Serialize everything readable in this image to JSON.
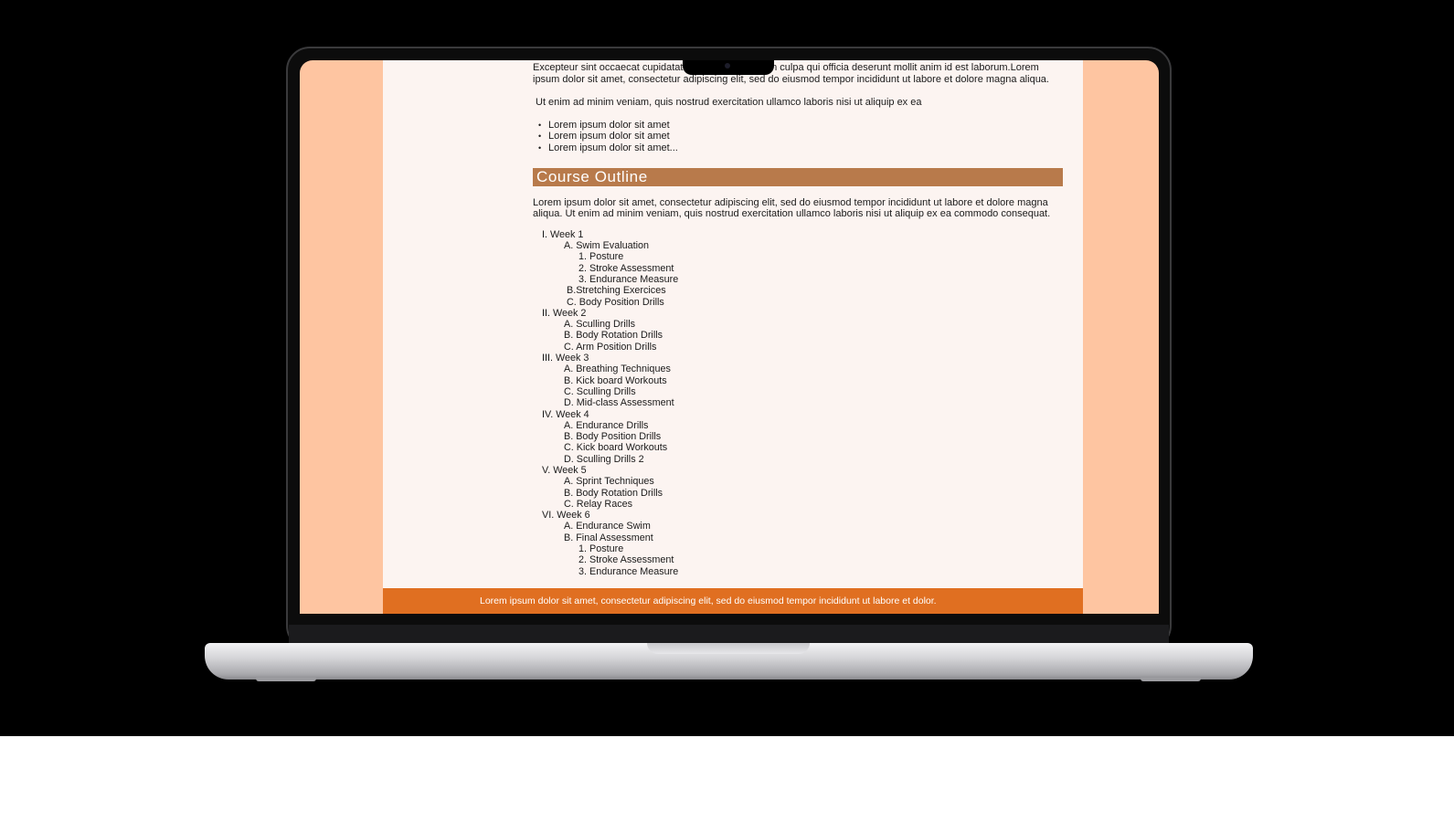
{
  "page": {
    "intro_paragraph": "Excepteur sint occaecat cupidatat non proident, sunt in culpa qui officia deserunt mollit anim id est laborum.Lorem ipsum dolor sit amet, consectetur adipiscing elit, sed do eiusmod tempor incididunt ut labore et dolore magna aliqua.",
    "second_paragraph": "Ut enim ad minim veniam, quis nostrud exercitation ullamco laboris nisi ut aliquip ex ea",
    "bullets": [
      "Lorem ipsum dolor sit amet",
      "Lorem ipsum dolor sit amet",
      "Lorem ipsum dolor sit amet..."
    ],
    "section_title": "Course Outline",
    "section_paragraph": "Lorem ipsum dolor sit amet, consectetur adipiscing elit, sed do eiusmod tempor incididunt ut labore et dolore magna aliqua. Ut enim ad minim veniam, quis nostrud exercitation ullamco laboris nisi ut aliquip ex ea commodo consequat.",
    "outline": {
      "week1": "I. Week 1",
      "week1_a": "A. Swim Evaluation",
      "week1_a1": "1. Posture",
      "week1_a2": "2. Stroke Assessment",
      "week1_a3": "3. Endurance Measure",
      "week1_b": "B.Stretching Exercices",
      "week1_c": "C. Body Position Drills",
      "week2": "II. Week 2",
      "week2_a": "A. Sculling Drills",
      "week2_b": "B. Body Rotation Drills",
      "week2_c": "C. Arm Position Drills",
      "week3": "III. Week 3",
      "week3_a": "A. Breathing Techniques",
      "week3_b": "B. Kick board Workouts",
      "week3_c": "C. Sculling Drills",
      "week3_d": "D. Mid-class Assessment",
      "week4": "IV. Week 4",
      "week4_a": "A. Endurance Drills",
      "week4_b": "B. Body Position Drills",
      "week4_c": "C. Kick board Workouts",
      "week4_d": "D. Sculling Drills 2",
      "week5": "V. Week 5",
      "week5_a": "A. Sprint Techniques",
      "week5_b": "B. Body Rotation Drills",
      "week5_c": "C. Relay Races",
      "week6": "VI. Week 6",
      "week6_a": "A. Endurance Swim",
      "week6_b": "B. Final Assessment",
      "week6_b1": "1. Posture",
      "week6_b2": "2. Stroke Assessment",
      "week6_b3": "3. Endurance Measure"
    },
    "footer_text": "Lorem ipsum dolor sit amet, consectetur adipiscing elit, sed do eiusmod tempor incididunt ut labore et dolor."
  },
  "colors": {
    "side_background": "#fec5a1",
    "page_background": "#fcf4f1",
    "section_bar": "#b87a4b",
    "footer_bar": "#e06f21"
  }
}
